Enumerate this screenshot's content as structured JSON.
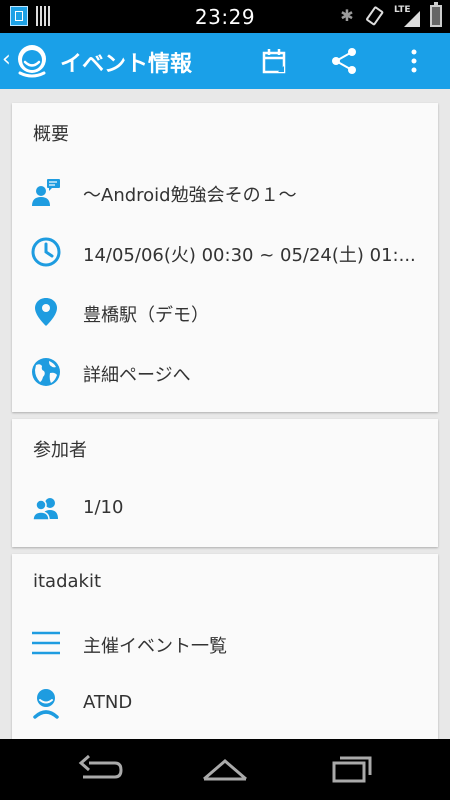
{
  "status_bar": {
    "time": "23:29",
    "network": "LTE"
  },
  "action_bar": {
    "title": "イベント情報",
    "icons": [
      "back-icon",
      "app-logo-icon",
      "calendar-icon",
      "share-icon",
      "overflow-menu-icon"
    ]
  },
  "overview": {
    "title": "概要",
    "items": [
      {
        "icon": "chat-person-icon",
        "label": "～Android勉強会その１～"
      },
      {
        "icon": "clock-icon",
        "label": "14/05/06(火) 00:30 ~ 05/24(土) 01:..."
      },
      {
        "icon": "location-pin-icon",
        "label": "豊橋駅（デモ）"
      },
      {
        "icon": "globe-icon",
        "label": "詳細ページへ"
      }
    ]
  },
  "participants": {
    "title": "参加者",
    "count": "1/10"
  },
  "organizer": {
    "title": "itadakit",
    "items": [
      {
        "icon": "list-icon",
        "label": "主催イベント一覧"
      },
      {
        "icon": "person-icon",
        "label": "ATND"
      }
    ]
  },
  "colors": {
    "accent": "#1aa0e8",
    "icon_blue": "#1e9ce0",
    "background": "#e8e8e8",
    "card": "#fafafa"
  }
}
